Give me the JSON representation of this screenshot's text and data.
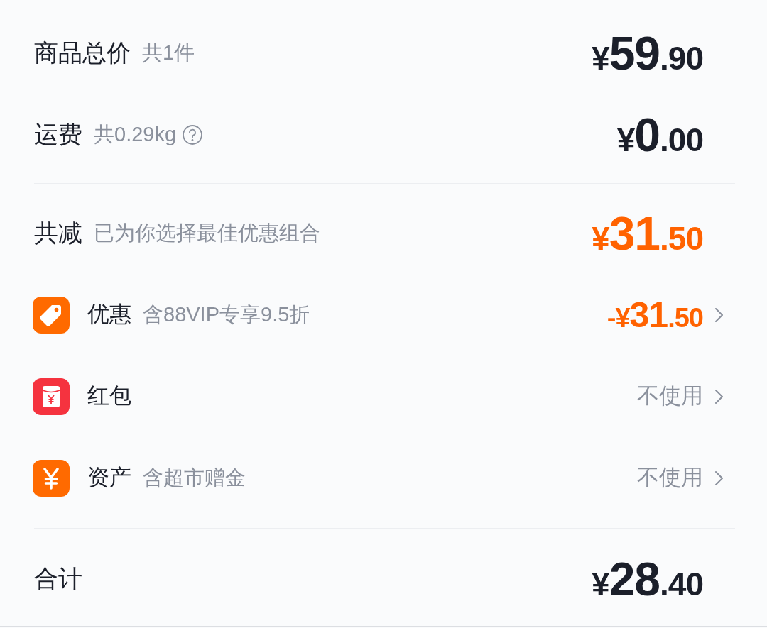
{
  "summary": [
    {
      "label": "商品总价",
      "note": "共1件",
      "amount": "¥59.90"
    },
    {
      "label": "运费",
      "note": "共0.29kg",
      "help": true,
      "amount": "¥0.00"
    }
  ],
  "discounts": {
    "label": "共减",
    "note": "已为你选择最佳优惠组合",
    "amount": "¥31.50",
    "items": [
      {
        "kind": "tag",
        "label": "优惠",
        "note": "含88VIP专享9.5折",
        "amount": "-¥31.50"
      },
      {
        "kind": "red-packet",
        "label": "红包",
        "value": "不使用"
      },
      {
        "kind": "yuan",
        "label": "资产",
        "note": "含超市赠金",
        "value": "不使用"
      }
    ]
  },
  "total": {
    "label": "合计",
    "amount": "¥28.40"
  }
}
